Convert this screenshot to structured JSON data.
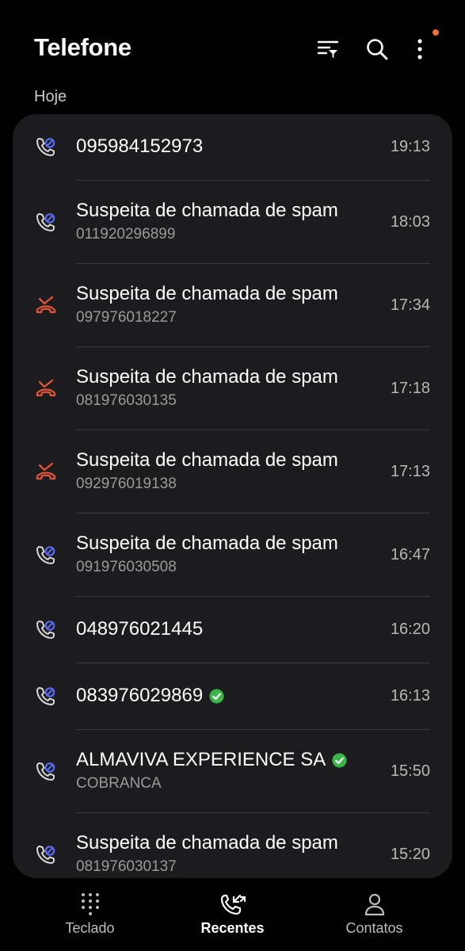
{
  "header": {
    "title": "Telefone",
    "icons": [
      "filter-icon",
      "search-icon",
      "more-vertical-icon"
    ]
  },
  "section_label": "Hoje",
  "colors": {
    "background": "#000000",
    "card": "#1c1c1e",
    "missed": "#e2533a",
    "call_icon": "#5b6cf2",
    "verified": "#3bb54a",
    "notification_dot": "#f26b3a"
  },
  "calls": [
    {
      "name": "095984152973",
      "sub": "",
      "time": "19:13",
      "type": "blocked",
      "verified": false
    },
    {
      "name": "Suspeita de chamada de spam",
      "sub": "011920296899",
      "time": "18:03",
      "type": "blocked",
      "verified": false
    },
    {
      "name": "Suspeita de chamada de spam",
      "sub": "097976018227",
      "time": "17:34",
      "type": "missed",
      "verified": false
    },
    {
      "name": "Suspeita de chamada de spam",
      "sub": "081976030135",
      "time": "17:18",
      "type": "missed",
      "verified": false
    },
    {
      "name": "Suspeita de chamada de spam",
      "sub": "092976019138",
      "time": "17:13",
      "type": "missed",
      "verified": false
    },
    {
      "name": "Suspeita de chamada de spam",
      "sub": "091976030508",
      "time": "16:47",
      "type": "blocked",
      "verified": false
    },
    {
      "name": "048976021445",
      "sub": "",
      "time": "16:20",
      "type": "blocked",
      "verified": false
    },
    {
      "name": "083976029869",
      "sub": "",
      "time": "16:13",
      "type": "blocked",
      "verified": true
    },
    {
      "name": "ALMAVIVA EXPERIENCE SA",
      "sub": "COBRANCA",
      "time": "15:50",
      "type": "blocked",
      "verified": true
    },
    {
      "name": "Suspeita de chamada de spam",
      "sub": "081976030137",
      "time": "15:20",
      "type": "blocked",
      "verified": false
    }
  ],
  "bottom_nav": [
    {
      "label": "Teclado",
      "icon": "keypad-icon",
      "active": false
    },
    {
      "label": "Recentes",
      "icon": "recents-icon",
      "active": true
    },
    {
      "label": "Contatos",
      "icon": "contacts-icon",
      "active": false
    }
  ]
}
